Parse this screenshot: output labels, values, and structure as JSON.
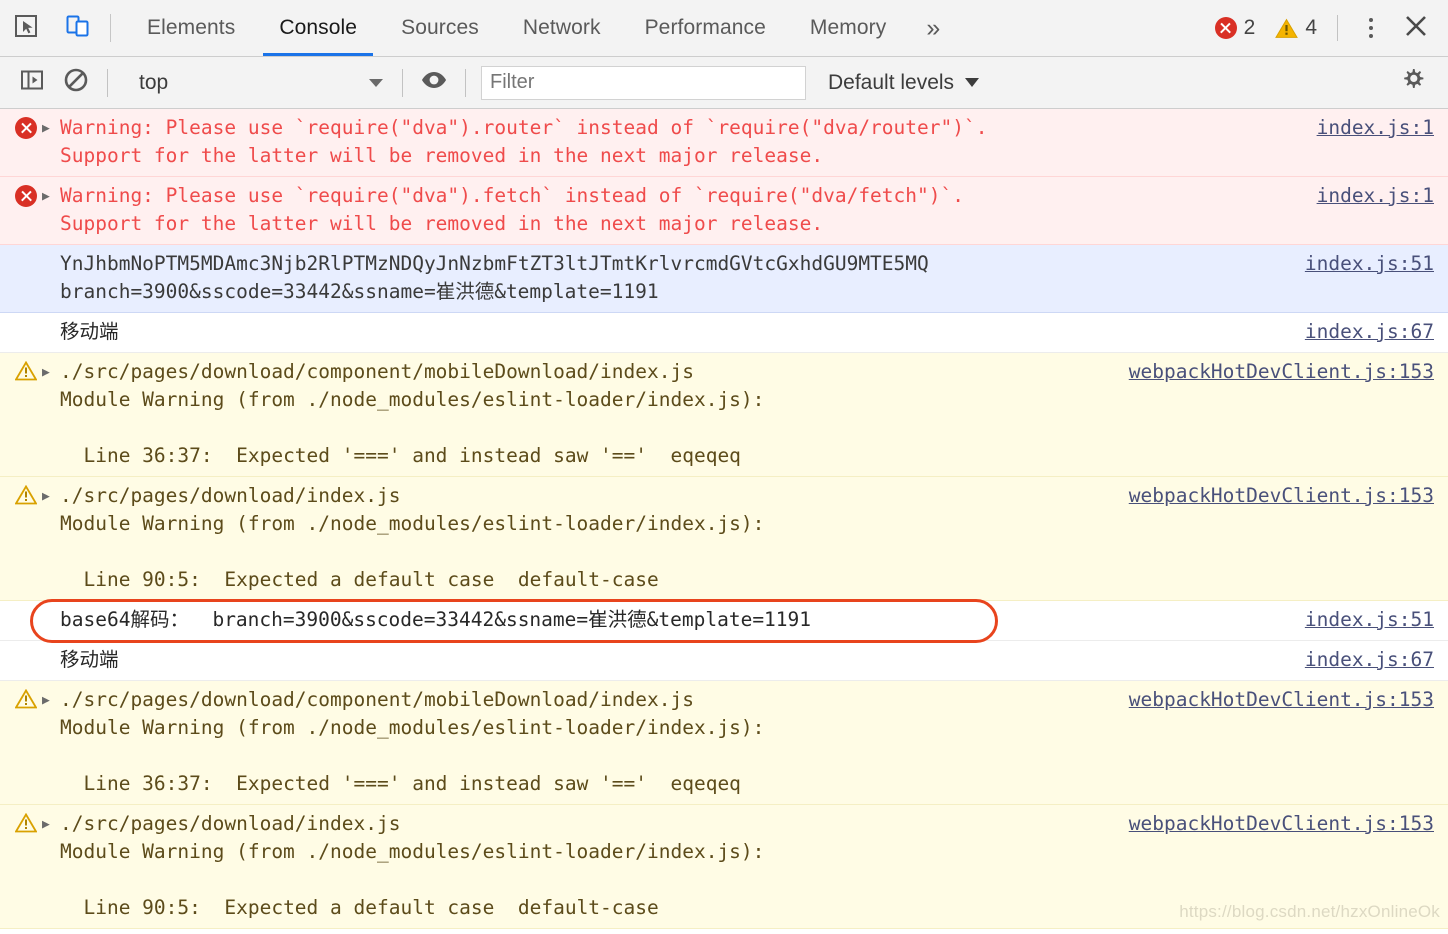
{
  "devtools": {
    "tabs": [
      {
        "label": "Elements",
        "active": false
      },
      {
        "label": "Console",
        "active": true
      },
      {
        "label": "Sources",
        "active": false
      },
      {
        "label": "Network",
        "active": false
      },
      {
        "label": "Performance",
        "active": false
      },
      {
        "label": "Memory",
        "active": false
      }
    ],
    "more_tabs_label": "»",
    "error_count": "2",
    "warning_count": "4",
    "accent_color": "#1a73e8",
    "error_color": "#d93025",
    "warning_color": "#f5b400",
    "icons": {
      "inspect": "inspect-element-icon",
      "device": "device-toolbar-icon",
      "kebab": "more-options-icon",
      "close": "close-devtools-icon"
    }
  },
  "console_toolbar": {
    "sidebar_toggle": "console-sidebar-icon",
    "clear_label": "clear-console-icon",
    "context_value": "top",
    "eye_label": "live-expression-icon",
    "filter_placeholder": "Filter",
    "filter_value": "",
    "levels_value": "Default levels",
    "settings_label": "settings-gear-icon"
  },
  "messages": [
    {
      "kind": "error",
      "arrow": true,
      "text": "Warning: Please use `require(\"dva\").router` instead of `require(\"dva/router\")`.\nSupport for the latter will be removed in the next major release.",
      "source": "index.js:1"
    },
    {
      "kind": "error",
      "arrow": true,
      "text": "Warning: Please use `require(\"dva\").fetch` instead of `require(\"dva/fetch\")`.\nSupport for the latter will be removed in the next major release.",
      "source": "index.js:1"
    },
    {
      "kind": "info",
      "arrow": false,
      "text": "YnJhbmNoPTM5MDAmc3Njb2RlPTMzNDQyJnNzbmFtZT3ltJTmtKrlvrcmdGVtcGxhdGU9MTE5MQ\nbranch=3900&sscode=33442&ssname=崔洪德&template=1191",
      "source": "index.js:51"
    },
    {
      "kind": "log",
      "arrow": false,
      "text": "移动端",
      "source": "index.js:67"
    },
    {
      "kind": "warn",
      "arrow": true,
      "text": "./src/pages/download/component/mobileDownload/index.js\nModule Warning (from ./node_modules/eslint-loader/index.js):\n\n  Line 36:37:  Expected '===' and instead saw '=='  eqeqeq",
      "source": "webpackHotDevClient.js:153"
    },
    {
      "kind": "warn",
      "arrow": true,
      "text": "./src/pages/download/index.js\nModule Warning (from ./node_modules/eslint-loader/index.js):\n\n  Line 90:5:  Expected a default case  default-case",
      "source": "webpackHotDevClient.js:153"
    },
    {
      "kind": "log",
      "arrow": false,
      "highlighted": true,
      "text": "base64解码：  branch=3900&sscode=33442&ssname=崔洪德&template=1191",
      "source": "index.js:51"
    },
    {
      "kind": "log",
      "arrow": false,
      "text": "移动端",
      "source": "index.js:67"
    },
    {
      "kind": "warn",
      "arrow": true,
      "text": "./src/pages/download/component/mobileDownload/index.js\nModule Warning (from ./node_modules/eslint-loader/index.js):\n\n  Line 36:37:  Expected '===' and instead saw '=='  eqeqeq",
      "source": "webpackHotDevClient.js:153"
    },
    {
      "kind": "warn",
      "arrow": true,
      "text": "./src/pages/download/index.js\nModule Warning (from ./node_modules/eslint-loader/index.js):\n\n  Line 90:5:  Expected a default case  default-case",
      "source": "webpackHotDevClient.js:153"
    }
  ],
  "annotation": {
    "color": "#e8441d",
    "target_index": 6
  },
  "watermark": "https://blog.csdn.net/hzxOnlineOk"
}
